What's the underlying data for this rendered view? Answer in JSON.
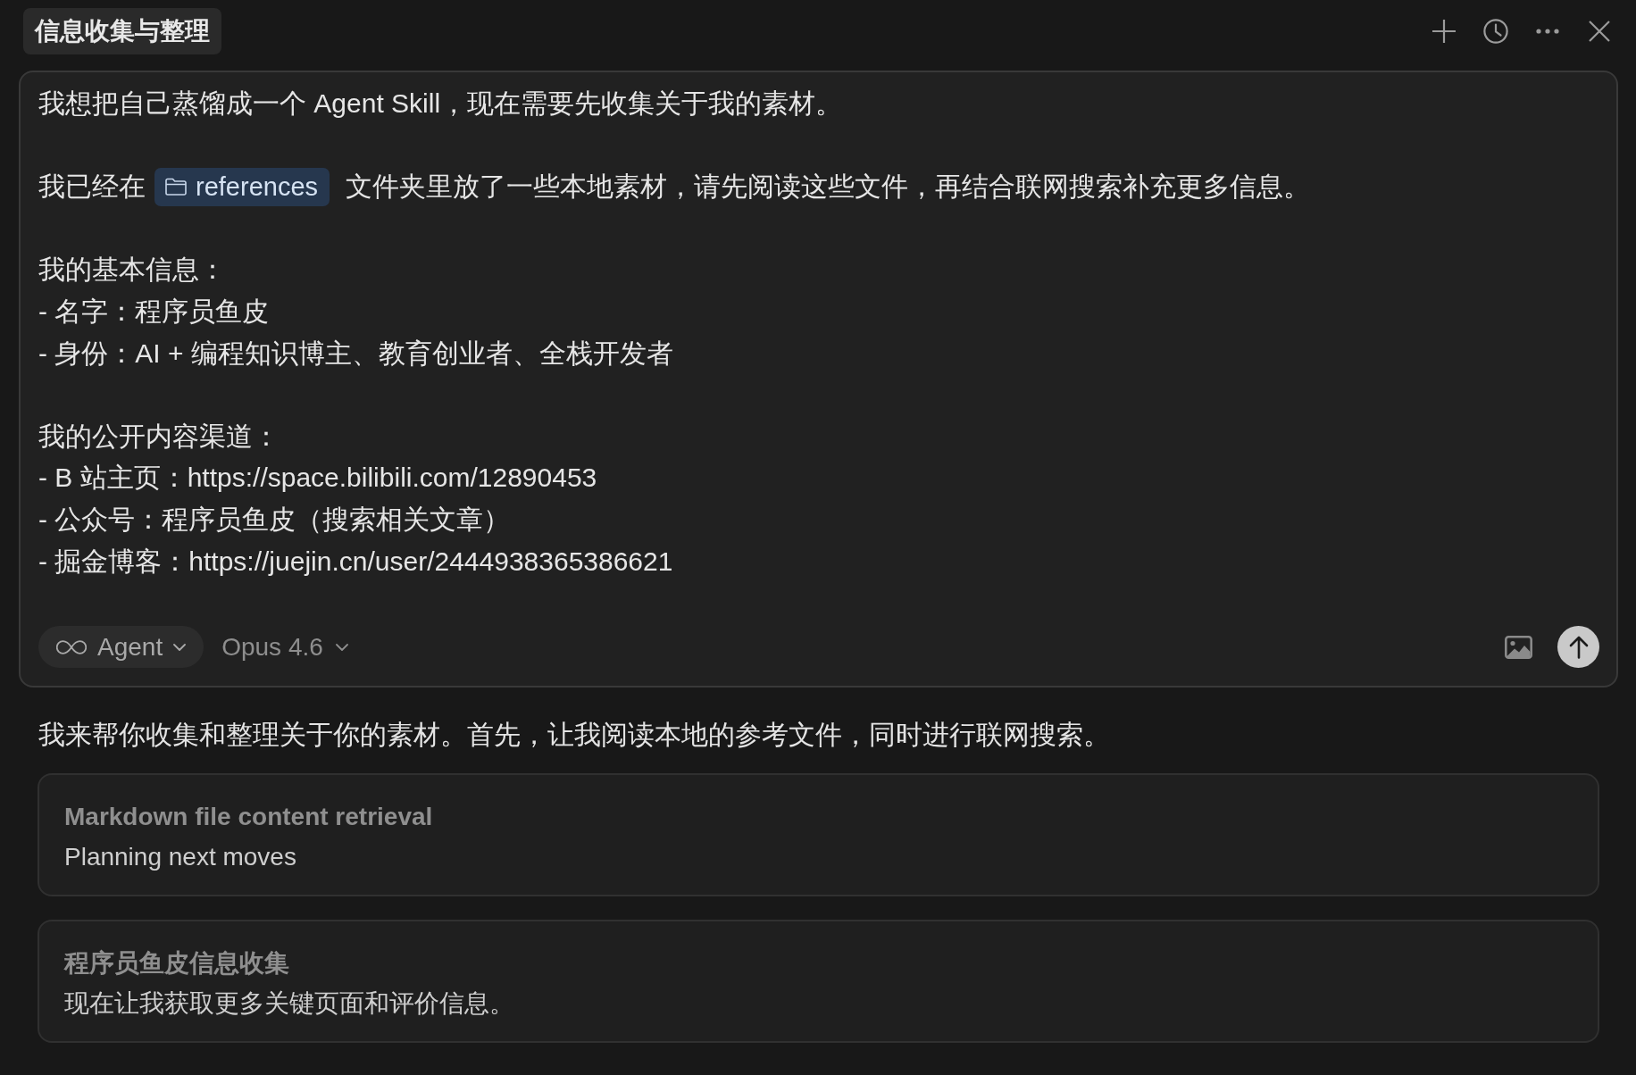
{
  "chat": {
    "title": "信息收集与整理"
  },
  "composer": {
    "paragraphs": [
      [
        {
          "kind": "text",
          "text": "我想把自己蒸馏成一个 Agent Skill，现在需要先收集关于我的素材。"
        }
      ],
      [
        {
          "kind": "mention",
          "before": "我已经在",
          "folder": "references",
          "after": "文件夹里放了一些本地素材，请先阅读这些文件，再结合联网搜索补充更多信息。"
        }
      ],
      [
        {
          "kind": "text",
          "text": "我的基本信息："
        },
        {
          "kind": "text",
          "text": "- 名字：程序员鱼皮"
        },
        {
          "kind": "text",
          "text": "- 身份：AI + 编程知识博主、教育创业者、全栈开发者"
        }
      ],
      [
        {
          "kind": "text",
          "text": "我的公开内容渠道："
        },
        {
          "kind": "text",
          "text": "- B 站主页：https://space.bilibili.com/12890453"
        },
        {
          "kind": "text",
          "text": "- 公众号：程序员鱼皮（搜索相关文章）"
        },
        {
          "kind": "text",
          "text": "- 掘金博客：https://juejin.cn/user/2444938365386621"
        }
      ]
    ],
    "mode": {
      "label": "Agent"
    },
    "model": {
      "label": "Opus 4.6"
    }
  },
  "reply": {
    "text": "我来帮你收集和整理关于你的素材。首先，让我阅读本地的参考文件，同时进行联网搜索。"
  },
  "steps": [
    {
      "title": "Markdown file content retrieval",
      "detail": "Planning next moves"
    },
    {
      "title": "程序员鱼皮信息收集",
      "detail": "现在让我获取更多关键页面和评价信息。"
    }
  ]
}
